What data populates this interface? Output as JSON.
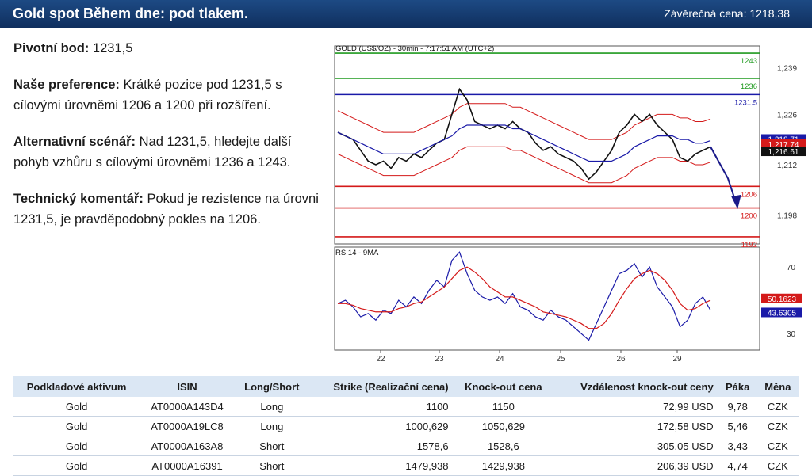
{
  "header": {
    "title": "Gold spot Během dne: pod tlakem.",
    "close_label": "Závěrečná cena:",
    "close_value": "1218,38"
  },
  "commentary": {
    "pivot_label": "Pivotní bod:",
    "pivot_value": "1231,5",
    "pref_label": "Naše preference:",
    "pref_text": "Krátké pozice pod 1231,5 s cílovými úrovněmi 1206 a 1200 při  rozšíření.",
    "alt_label": "Alternativní scénář:",
    "alt_text": "Nad 1231,5, hledejte další pohyb vzhůru s cílovými úrovněmi 1236 a 1243.",
    "tech_label": "Technický komentář:",
    "tech_text": "Pokud je rezistence na úrovni 1231,5, je pravděpodobný pokles na 1206."
  },
  "chart_data": {
    "type": "line",
    "title": "GOLD (US$/OZ) - 30min - 7:17:51 AM (UTC+2)",
    "x_ticks": [
      "22",
      "23",
      "24",
      "25",
      "26",
      "29"
    ],
    "price_axis": {
      "ticks": [
        1239,
        1226,
        1212,
        1198
      ],
      "ylim": [
        1190,
        1245
      ]
    },
    "levels": [
      {
        "label": "1243",
        "value": 1243,
        "color": "#1f9a1f"
      },
      {
        "label": "1236",
        "value": 1236,
        "color": "#1f9a1f"
      },
      {
        "label": "1231.5",
        "value": 1231.5,
        "color": "#1a1aa8"
      },
      {
        "label": "1206",
        "value": 1206,
        "color": "#d41a1a"
      },
      {
        "label": "1200",
        "value": 1200,
        "color": "#d41a1a"
      },
      {
        "label": "1192",
        "value": 1192,
        "color": "#d41a1a"
      }
    ],
    "price_tags": [
      {
        "label": "1,218.71",
        "color": "#1a1aa8"
      },
      {
        "label": "1,217.74",
        "color": "#d41a1a"
      },
      {
        "label": "1,216.61",
        "color": "#111111"
      }
    ],
    "price_series": [
      1221,
      1220,
      1219,
      1216,
      1213,
      1212,
      1213,
      1211,
      1214,
      1213,
      1215,
      1214,
      1216,
      1218,
      1219,
      1226,
      1233,
      1230,
      1224,
      1223,
      1222,
      1223,
      1222,
      1224,
      1222,
      1221,
      1218,
      1216,
      1217,
      1215,
      1214,
      1213,
      1211,
      1208,
      1210,
      1213,
      1216,
      1221,
      1223,
      1226,
      1224,
      1226,
      1223,
      1221,
      1219,
      1214,
      1213,
      1215,
      1216,
      1217
    ],
    "ma_series": [
      1221,
      1220,
      1219,
      1218,
      1217,
      1216,
      1215,
      1215,
      1215,
      1215,
      1215,
      1216,
      1217,
      1218,
      1219,
      1220,
      1222,
      1223,
      1223,
      1223,
      1223,
      1223,
      1223,
      1222,
      1222,
      1221,
      1220,
      1219,
      1218,
      1217,
      1216,
      1215,
      1214,
      1213,
      1213,
      1213,
      1213,
      1214,
      1215,
      1217,
      1218,
      1219,
      1220,
      1220,
      1220,
      1219,
      1219,
      1218,
      1218,
      1218.7
    ],
    "rsi": {
      "title": "RSI14 - 9MA",
      "ticks": [
        70,
        30
      ],
      "ylim": [
        20,
        82
      ],
      "tags": [
        {
          "label": "50.1623",
          "color": "#d41a1a"
        },
        {
          "label": "43.6305",
          "color": "#1a1aa8"
        }
      ],
      "series": [
        48,
        50,
        46,
        40,
        42,
        38,
        44,
        42,
        50,
        46,
        52,
        48,
        56,
        62,
        58,
        74,
        79,
        66,
        56,
        52,
        50,
        52,
        48,
        54,
        46,
        44,
        40,
        38,
        44,
        40,
        38,
        34,
        30,
        26,
        36,
        46,
        56,
        66,
        68,
        72,
        64,
        70,
        58,
        52,
        46,
        34,
        38,
        48,
        52,
        44
      ],
      "ma": [
        48,
        48,
        47,
        45,
        44,
        43,
        43,
        43,
        45,
        46,
        48,
        49,
        52,
        55,
        58,
        63,
        68,
        70,
        67,
        63,
        58,
        55,
        52,
        52,
        50,
        48,
        46,
        43,
        42,
        41,
        40,
        38,
        36,
        33,
        33,
        36,
        42,
        50,
        57,
        63,
        66,
        68,
        66,
        62,
        56,
        48,
        44,
        45,
        48,
        50
      ]
    }
  },
  "table": {
    "headers": [
      "Podkladové aktivum",
      "ISIN",
      "Long/Short",
      "Strike (Realizační cena)",
      "Knock-out cena",
      "Vzdálenost knock-out ceny",
      "Páka",
      "Měna"
    ],
    "rows": [
      [
        "Gold",
        "AT0000A143D4",
        "Long",
        "1100",
        "1150",
        "72,99 USD",
        "9,78",
        "CZK"
      ],
      [
        "Gold",
        "AT0000A19LC8",
        "Long",
        "1000,629",
        "1050,629",
        "172,58 USD",
        "5,46",
        "CZK"
      ],
      [
        "Gold",
        "AT0000A163A8",
        "Short",
        "1578,6",
        "1528,6",
        "305,05 USD",
        "3,43",
        "CZK"
      ],
      [
        "Gold",
        "AT0000A16391",
        "Short",
        "1479,938",
        "1429,938",
        "206,39 USD",
        "4,74",
        "CZK"
      ]
    ]
  }
}
